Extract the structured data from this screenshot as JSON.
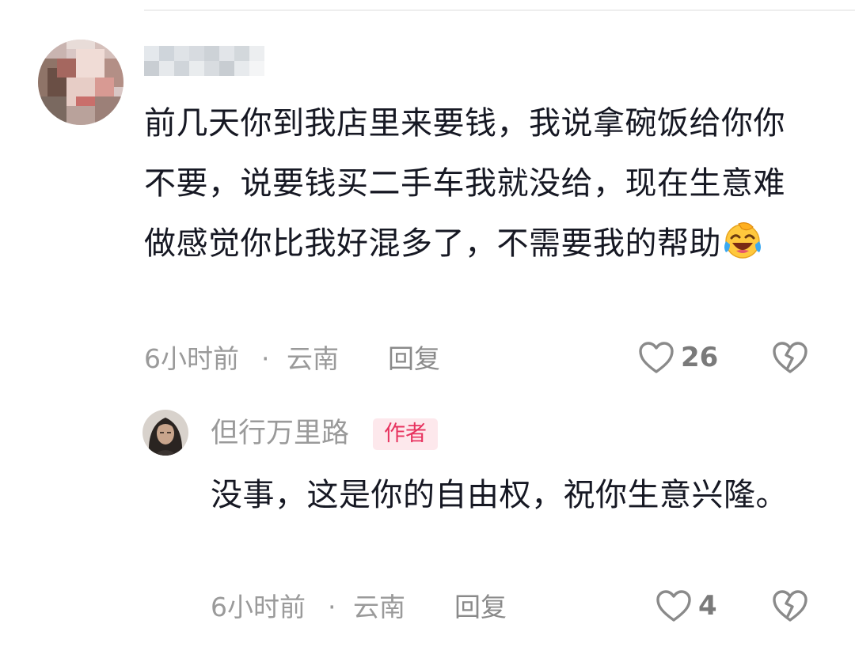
{
  "comment": {
    "username": "",
    "text": "前几天你到我店里来要钱，我说拿碗饭给你你不要，说要钱买二手车我就没给，现在生意难做感觉你比我好混多了，不需要我的帮助",
    "emoji": "crying-laughing-emoji",
    "time": "6小时前",
    "separator": "·",
    "location": "云南",
    "reply_label": "回复",
    "likes": "26"
  },
  "reply": {
    "username": "但行万里路",
    "badge": "作者",
    "text": "没事，这是你的自由权，祝你生意兴隆。",
    "time": "6小时前",
    "separator": "·",
    "location": "云南",
    "reply_label": "回复",
    "likes": "4"
  },
  "icons": {
    "like": "heart-outline-icon",
    "dislike": "broken-heart-icon"
  },
  "colors": {
    "text_primary": "#161823",
    "text_secondary": "#9a9a9a",
    "author_badge_bg": "#fde8ec",
    "author_badge_text": "#e7335f"
  }
}
